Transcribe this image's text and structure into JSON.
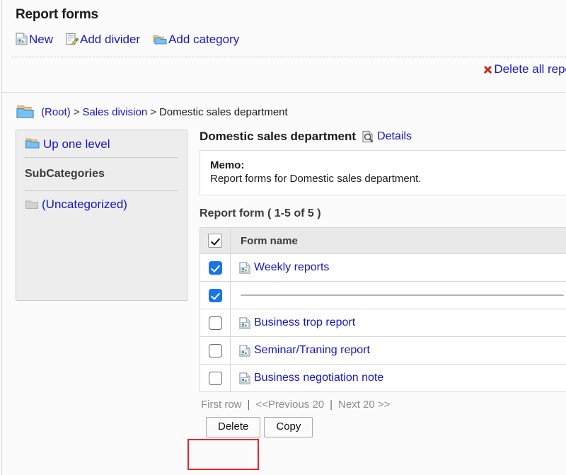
{
  "page": {
    "title": "Report forms"
  },
  "toolbar": {
    "items": [
      {
        "label": "New",
        "icon": "report-form-icon"
      },
      {
        "label": "Add divider",
        "icon": "edit-note-icon"
      },
      {
        "label": "Add category",
        "icon": "folder-add-icon"
      }
    ],
    "delete_all": {
      "label": "Delete all repo",
      "icon": "red-x-icon"
    }
  },
  "breadcrumb": {
    "icon": "folders-icon",
    "items": [
      {
        "label": "(Root)",
        "link": true
      },
      {
        "label": "Sales division",
        "link": true
      },
      {
        "label": "Domestic sales department",
        "link": false
      }
    ],
    "separator": ">"
  },
  "sidebar": {
    "up_one_level": {
      "label": "Up one level",
      "icon": "folder-up-icon"
    },
    "subcategories_heading": "SubCategories",
    "categories": [
      {
        "label": "(Uncategorized)",
        "icon": "folder-gray-icon"
      }
    ]
  },
  "main": {
    "heading": "Domestic sales department",
    "details_link": {
      "label": "Details",
      "icon": "magnifier-doc-icon"
    },
    "memo": {
      "label": "Memo:",
      "text": "Report forms for Domestic sales department."
    },
    "section_title": "Report form ( 1-5 of 5 )",
    "table": {
      "header_checkbox_checked": true,
      "columns": [
        "",
        "Form name"
      ],
      "rows": [
        {
          "checked": true,
          "type": "form",
          "name": "Weekly reports",
          "icon": "report-form-icon"
        },
        {
          "checked": true,
          "type": "divider",
          "name": "",
          "icon": ""
        },
        {
          "checked": false,
          "type": "form",
          "name": "Business trop report",
          "icon": "report-form-icon"
        },
        {
          "checked": false,
          "type": "form",
          "name": "Seminar/Traning report",
          "icon": "report-form-icon"
        },
        {
          "checked": false,
          "type": "form",
          "name": "Business negotiation note",
          "icon": "report-form-icon"
        }
      ]
    },
    "pager": {
      "first": "First row",
      "sep1": "|",
      "previous": "<<Previous 20",
      "sep2": "|",
      "next": "Next 20 >>"
    },
    "buttons": {
      "delete": "Delete",
      "copy": "Copy"
    }
  },
  "colors": {
    "link": "#1515cc",
    "checkbox_checked": "#1a73e8",
    "highlight_box": "#e8262a",
    "delete_x": "#cc2a18"
  }
}
